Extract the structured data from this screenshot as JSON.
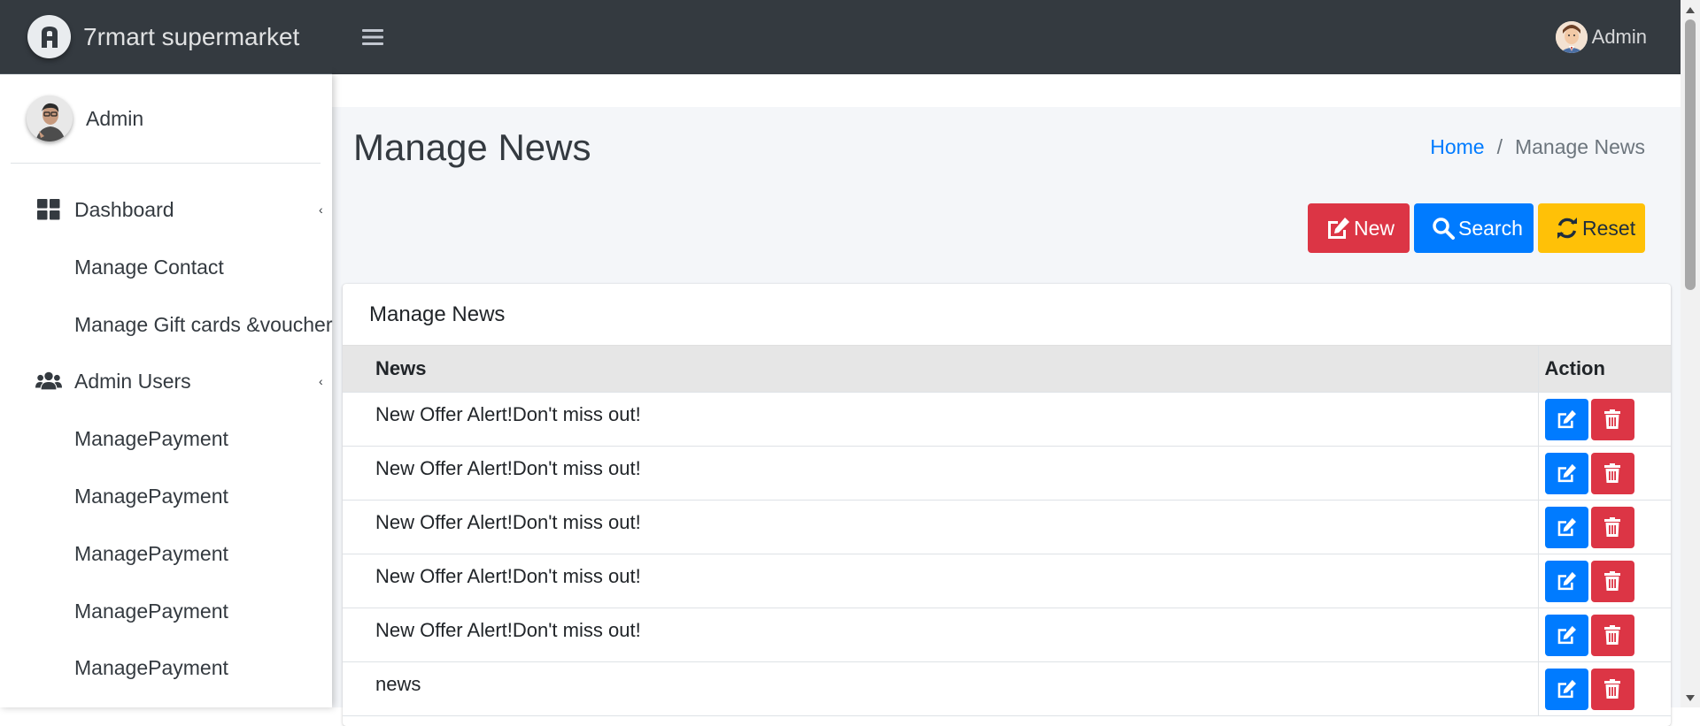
{
  "brand": {
    "name": "7rmart supermarket",
    "logo_icon": "brand-logo-icon"
  },
  "topbar": {
    "menu_icon": "bars-icon",
    "user_name": "Admin"
  },
  "sidebar": {
    "user_name": "Admin",
    "items": [
      {
        "label": "Dashboard",
        "icon": "th-large-icon",
        "has_caret": true,
        "caret": "‹"
      },
      {
        "label": "Manage Contact",
        "icon": "",
        "has_caret": false
      },
      {
        "label": "Manage Gift cards &voucher",
        "icon": "",
        "has_caret": false
      },
      {
        "label": "Admin Users",
        "icon": "users-icon",
        "has_caret": true,
        "caret": "‹"
      },
      {
        "label": "ManagePayment",
        "icon": "",
        "has_caret": false
      },
      {
        "label": "ManagePayment",
        "icon": "",
        "has_caret": false
      },
      {
        "label": "ManagePayment",
        "icon": "",
        "has_caret": false
      },
      {
        "label": "ManagePayment",
        "icon": "",
        "has_caret": false
      },
      {
        "label": "ManagePayment",
        "icon": "",
        "has_caret": false
      }
    ]
  },
  "page": {
    "title": "Manage News",
    "breadcrumb": {
      "home": "Home",
      "separator": "/",
      "current": "Manage News"
    }
  },
  "actions": {
    "new_label": "New",
    "search_label": "Search",
    "reset_label": "Reset"
  },
  "card": {
    "title": "Manage News",
    "table": {
      "columns": [
        "News",
        "Action"
      ],
      "rows": [
        "New Offer Alert!Don't miss out!",
        "New Offer Alert!Don't miss out!",
        "New Offer Alert!Don't miss out!",
        "New Offer Alert!Don't miss out!",
        "New Offer Alert!Don't miss out!",
        "news"
      ]
    }
  },
  "colors": {
    "navbar": "#343a40",
    "primary": "#007bff",
    "danger": "#dc3545",
    "warning": "#ffc107",
    "content_bg": "#f4f6f9",
    "table_header_bg": "#e6e6e6"
  }
}
